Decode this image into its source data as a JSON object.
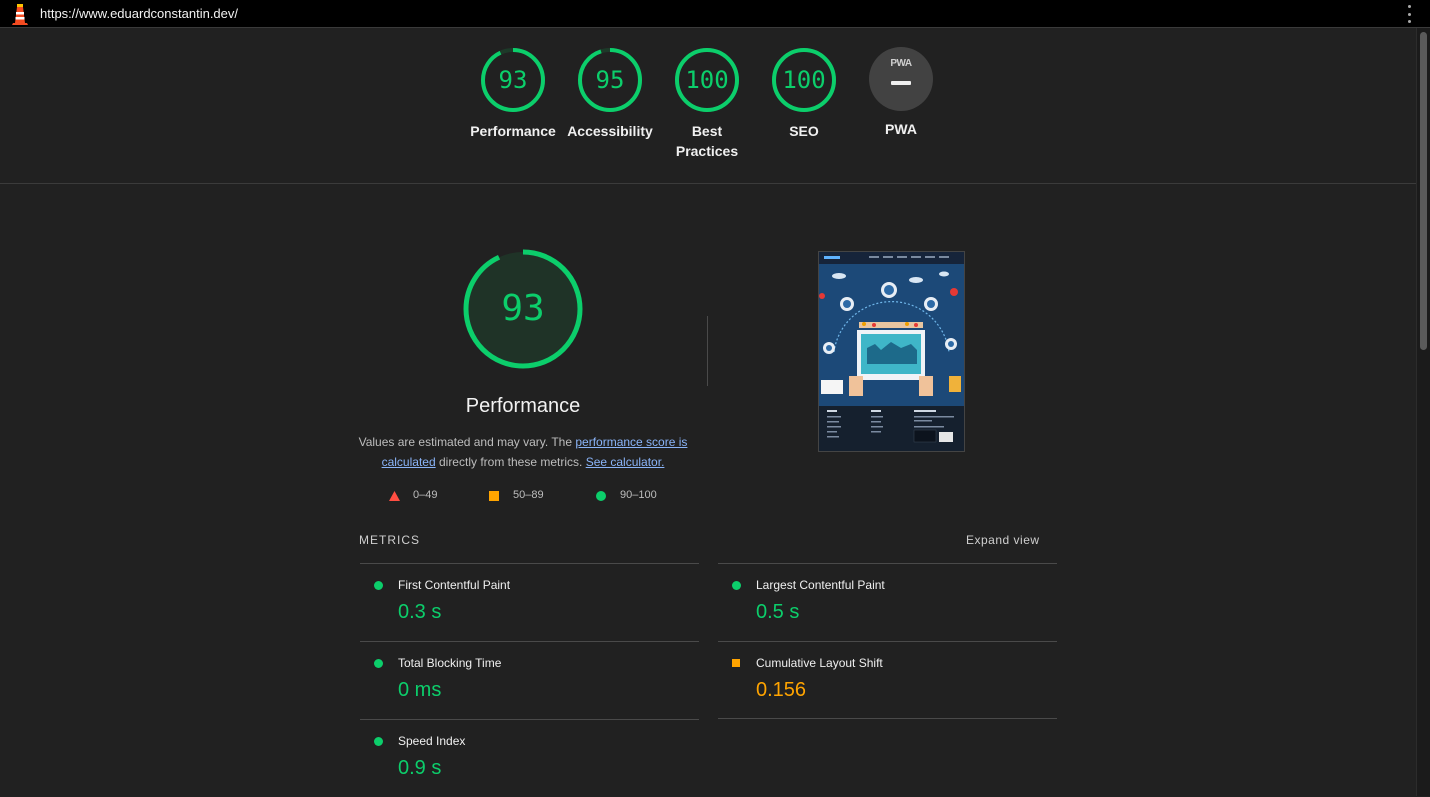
{
  "colors": {
    "pass": "#0cce6b",
    "average": "#ffa400",
    "fail": "#ff4e42",
    "bg": "#212121"
  },
  "topbar": {
    "url": "https://www.eduardconstantin.dev/",
    "logo_icon": "lighthouse-icon",
    "menu_icon": "kebab-menu-icon"
  },
  "summary": {
    "scores": [
      {
        "value": "93",
        "score": 93,
        "label": "Performance"
      },
      {
        "value": "95",
        "score": 95,
        "label": "Accessibility"
      },
      {
        "value": "100",
        "score": 100,
        "label": "Best Practices"
      },
      {
        "value": "100",
        "score": 100,
        "label": "SEO"
      }
    ],
    "pwa": {
      "badge": "PWA",
      "label": "PWA"
    }
  },
  "performance": {
    "score": "93",
    "score_value": 93,
    "title": "Performance",
    "desc_pre": "Values are estimated and may vary. The ",
    "desc_link1": "performance score is calculated",
    "desc_mid": " directly from these metrics. ",
    "desc_link2": "See calculator."
  },
  "legend": {
    "fail": "0–49",
    "average": "50–89",
    "pass": "90–100"
  },
  "metrics": {
    "header": "METRICS",
    "expand": "Expand view",
    "items": [
      {
        "name": "First Contentful Paint",
        "value": "0.3 s",
        "status": "pass"
      },
      {
        "name": "Largest Contentful Paint",
        "value": "0.5 s",
        "status": "pass"
      },
      {
        "name": "Total Blocking Time",
        "value": "0 ms",
        "status": "pass"
      },
      {
        "name": "Cumulative Layout Shift",
        "value": "0.156",
        "status": "average"
      },
      {
        "name": "Speed Index",
        "value": "0.9 s",
        "status": "pass"
      }
    ]
  }
}
